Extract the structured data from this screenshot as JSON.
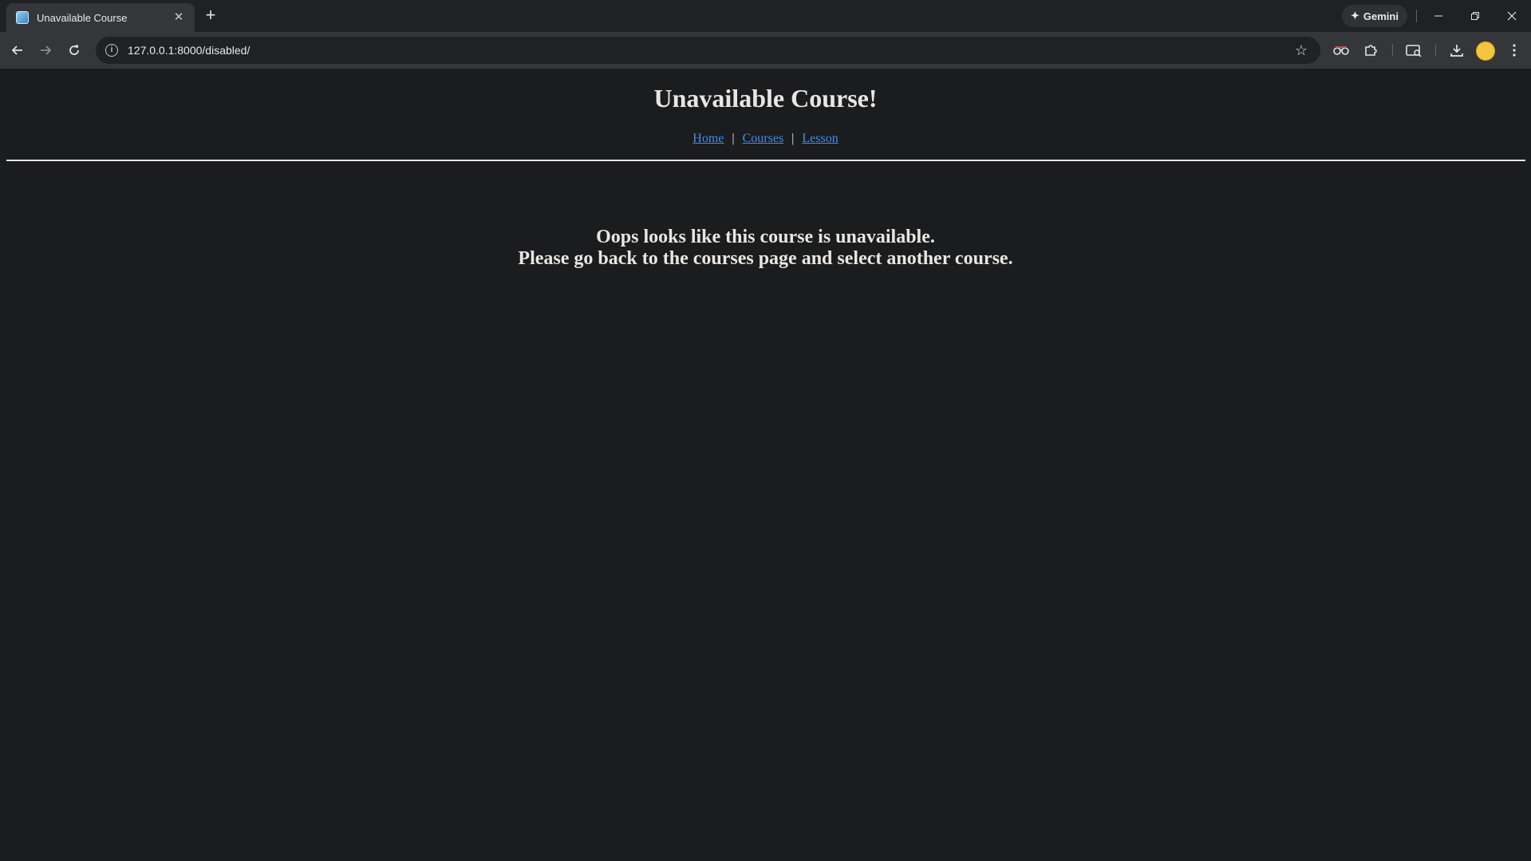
{
  "browser": {
    "tab": {
      "title": "Unavailable Course",
      "favicon": "site-favicon",
      "close_icon": "close-icon"
    },
    "new_tab_icon": "plus-icon",
    "gemini_label": "Gemini",
    "window_controls": [
      "minimize-icon",
      "restore-icon",
      "close-icon"
    ],
    "toolbar": {
      "back_icon": "arrow-left-icon",
      "forward_icon": "arrow-right-icon",
      "reload_icon": "reload-icon",
      "url": "127.0.0.1:8000/disabled/",
      "site_info_icon": "info-icon",
      "bookmark_icon": "star-icon",
      "extensions": [
        "glasses-extension-icon",
        "puzzle-extensions-icon",
        "reading-mode-icon",
        "download-icon",
        "profile-avatar",
        "kebab-menu-icon"
      ]
    }
  },
  "page": {
    "title": "Unavailable Course!",
    "nav": {
      "home": "Home",
      "courses": "Courses",
      "lesson": "Lesson",
      "separator": "|"
    },
    "message_line1": "Oops looks like this course is unavailable.",
    "message_line2": "Please go back to the courses page and select another course."
  },
  "colors": {
    "page_background": "#1b1c1e",
    "link": "#3c8cff",
    "text": "#e8e6e3"
  }
}
